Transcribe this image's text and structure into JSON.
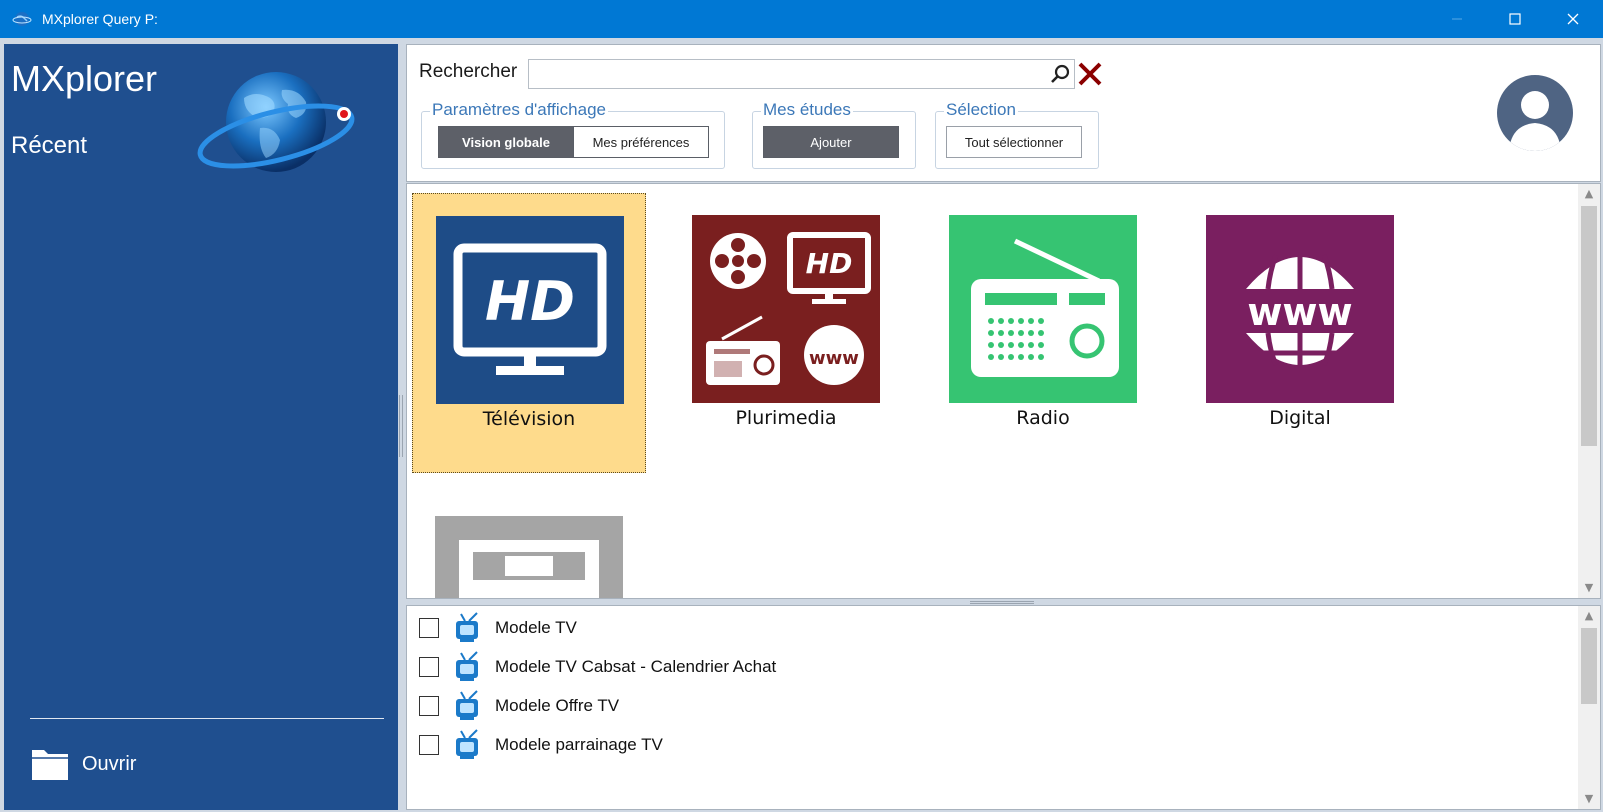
{
  "window": {
    "title": "MXplorer Query P:"
  },
  "sidebar": {
    "brand": "MXplorer",
    "recent_label": "Récent",
    "open_label": "Ouvrir"
  },
  "search": {
    "label": "Rechercher",
    "value": "",
    "placeholder": ""
  },
  "groups": {
    "display": {
      "legend": "Paramètres d'affichage",
      "options": [
        "Vision globale",
        "Mes préférences"
      ],
      "selected": "Vision globale"
    },
    "studies": {
      "legend": "Mes études",
      "add_label": "Ajouter"
    },
    "selection": {
      "legend": "Sélection",
      "select_all_label": "Tout sélectionner"
    }
  },
  "tiles": [
    {
      "label": "Télévision",
      "icon": "tv-hd-icon",
      "color": "#1e4c87",
      "selected": true
    },
    {
      "label": "Plurimedia",
      "icon": "plurimedia-icon",
      "color": "#7a1f1f",
      "selected": false
    },
    {
      "label": "Radio",
      "icon": "radio-icon",
      "color": "#36c472",
      "selected": false
    },
    {
      "label": "Digital",
      "icon": "www-globe-icon",
      "color": "#7a1f60",
      "selected": false
    },
    {
      "label": "",
      "icon": "press-icon",
      "color": "#a5a5a5",
      "selected": false
    }
  ],
  "models": [
    {
      "label": "Modele TV",
      "checked": false
    },
    {
      "label": "Modele TV Cabsat - Calendrier Achat",
      "checked": false
    },
    {
      "label": "Modele Offre TV",
      "checked": false
    },
    {
      "label": "Modele parrainage TV",
      "checked": false
    }
  ],
  "colors": {
    "titlebar": "#0078d4",
    "sidebar": "#1f4f8f",
    "accent_legend": "#3c78b8",
    "selected_tile": "#fedb8c",
    "clear_x": "#8b0000"
  }
}
